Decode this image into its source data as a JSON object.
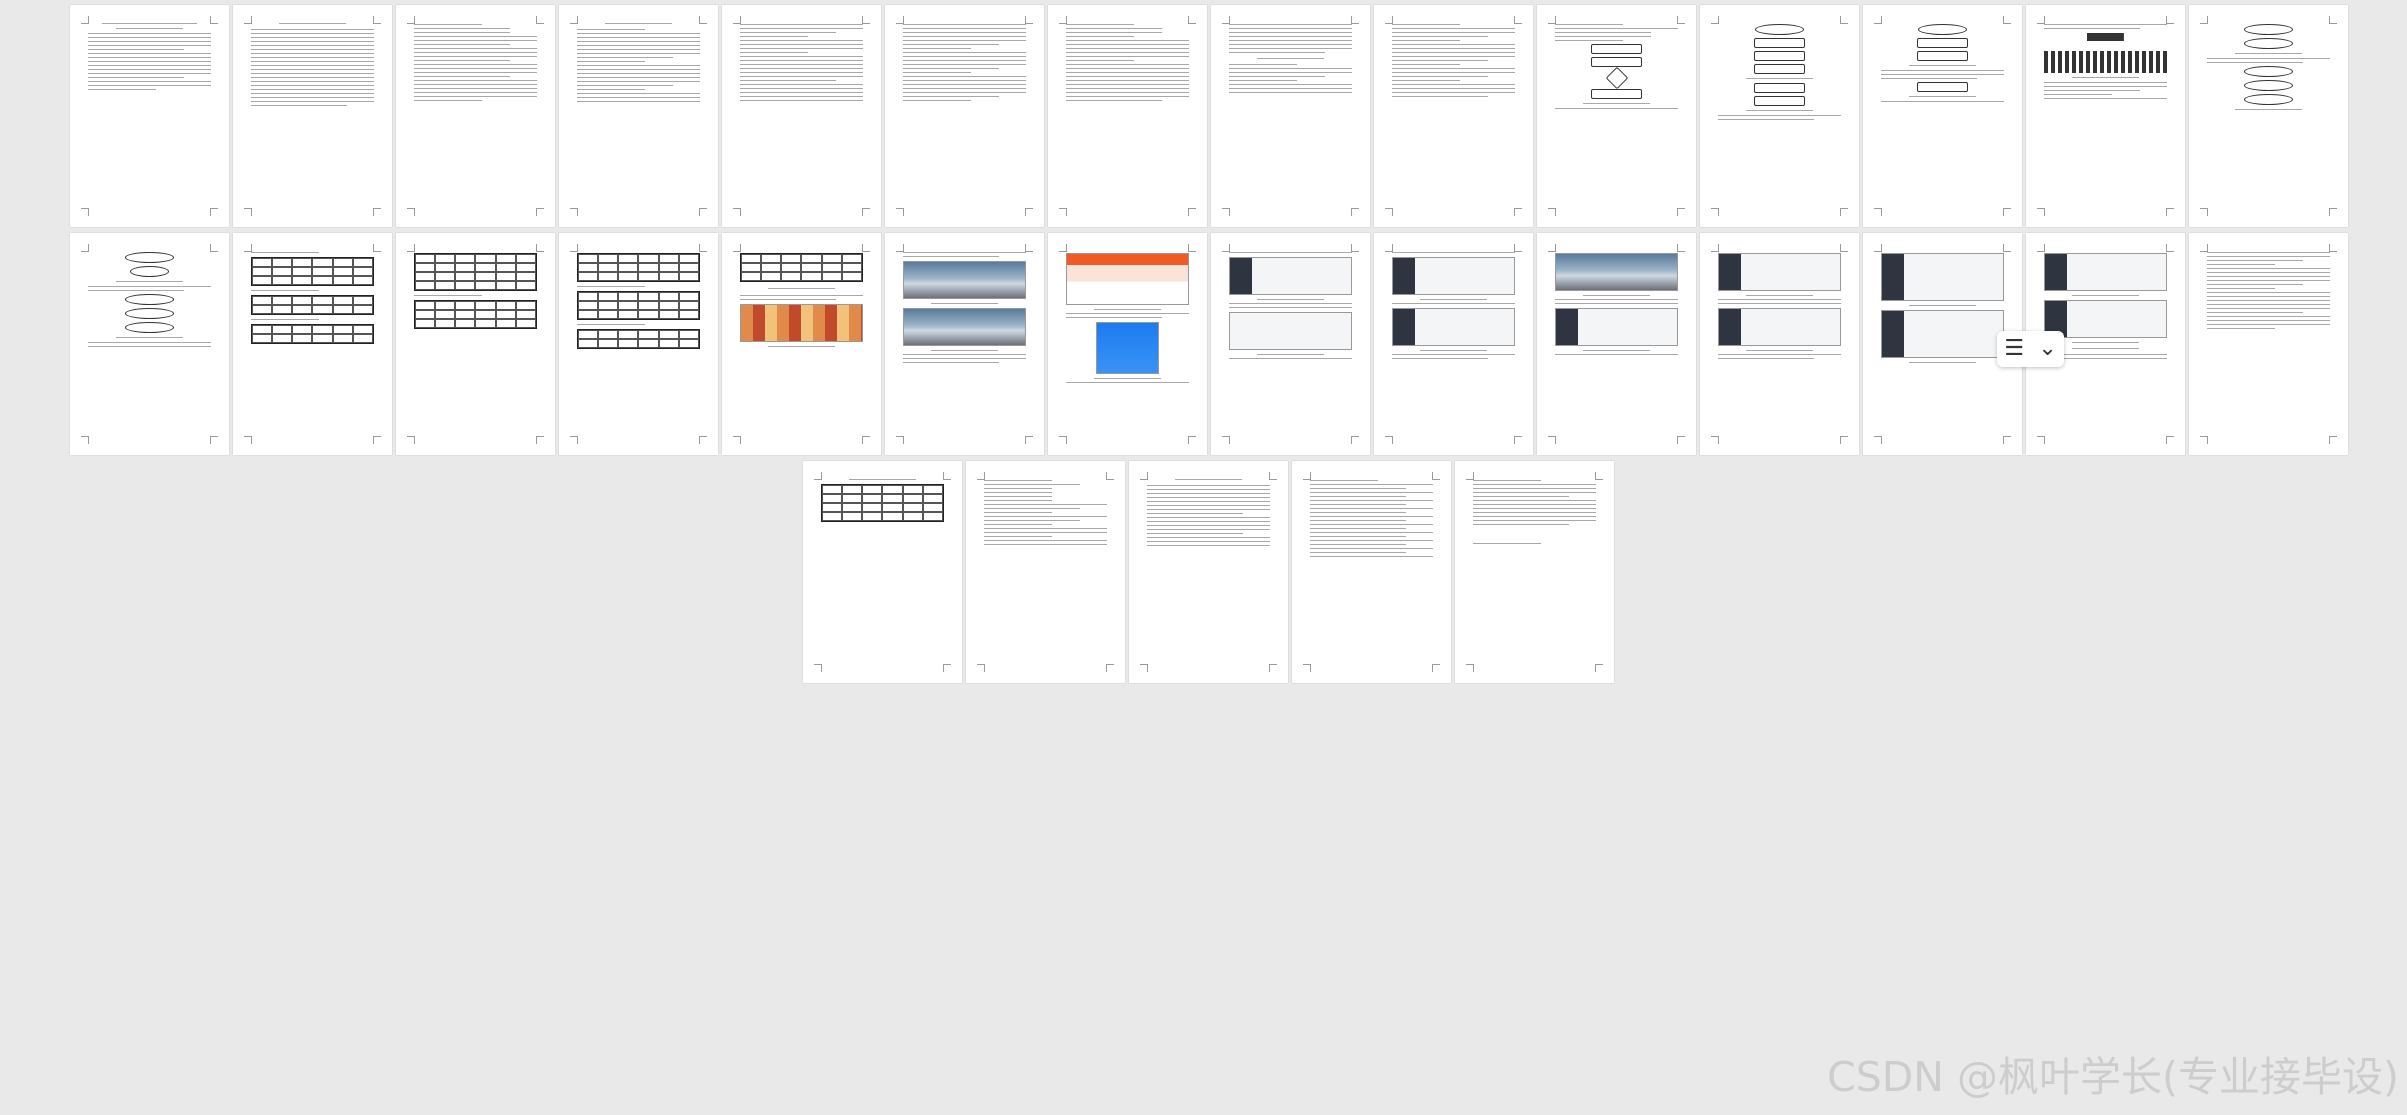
{
  "viewer": {
    "toolbar": {
      "view_mode_icon": "list-view-icon",
      "expand_icon": "chevron-down-icon"
    }
  },
  "watermark": "CSDN @枫叶学长(专业接毕设)",
  "pages_count": 30
}
